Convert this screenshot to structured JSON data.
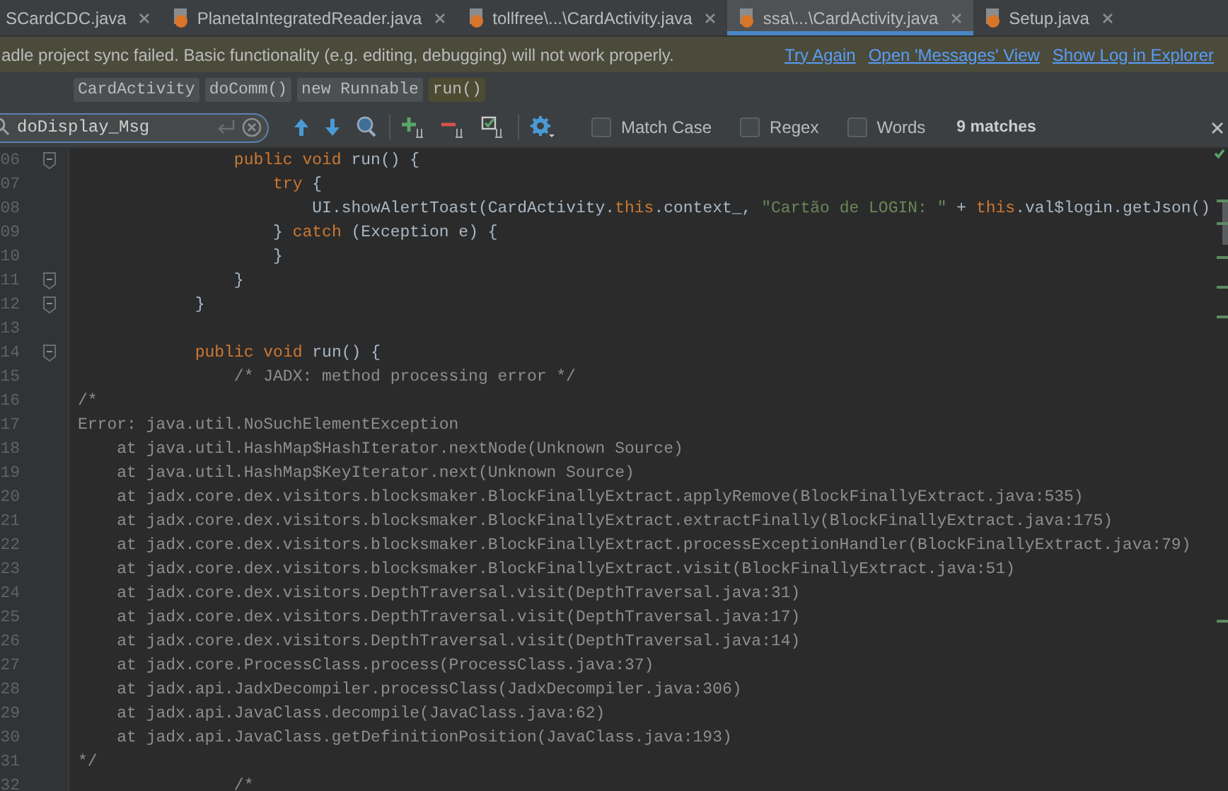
{
  "tabs": [
    {
      "label": "SCardCDC.java",
      "has_icon": false,
      "selected": false
    },
    {
      "label": "PlanetaIntegratedReader.java",
      "has_icon": true,
      "selected": false
    },
    {
      "label": "tollfree\\...\\CardActivity.java",
      "has_icon": true,
      "selected": false
    },
    {
      "label": "ssa\\...\\CardActivity.java",
      "has_icon": true,
      "selected": true
    },
    {
      "label": "Setup.java",
      "has_icon": true,
      "selected": false
    }
  ],
  "notification": {
    "message": "adle project sync failed. Basic functionality (e.g. editing, debugging) will not work properly.",
    "links": [
      "Try Again",
      "Open 'Messages' View",
      "Show Log in Explorer"
    ]
  },
  "breadcrumbs": [
    {
      "label": "CardActivity",
      "selected": false
    },
    {
      "label": "doComm()",
      "selected": false
    },
    {
      "label": "new Runnable",
      "selected": false
    },
    {
      "label": "run()",
      "selected": true
    }
  ],
  "search": {
    "value": "doDisplay_Msg",
    "options": [
      {
        "label": "Match Case",
        "checked": false
      },
      {
        "label": "Regex",
        "checked": false
      },
      {
        "label": "Words",
        "checked": false
      }
    ],
    "match_count": "9 matches"
  },
  "editor": {
    "lines": [
      {
        "number": "06",
        "fold": true,
        "tokens": [
          {
            "kind": "keyword",
            "text": "                public void"
          },
          {
            "kind": "plain",
            "text": " run() {"
          }
        ]
      },
      {
        "number": "07",
        "fold": false,
        "tokens": [
          {
            "kind": "keyword",
            "text": "                    try"
          },
          {
            "kind": "plain",
            "text": " {"
          }
        ]
      },
      {
        "number": "08",
        "fold": false,
        "tokens": [
          {
            "kind": "plain",
            "text": "                        UI.showAlertToast(CardActivity."
          },
          {
            "kind": "keyword",
            "text": "this"
          },
          {
            "kind": "plain",
            "text": ".context_, "
          },
          {
            "kind": "string",
            "text": "\"Cartão de LOGIN: \""
          },
          {
            "kind": "plain",
            "text": " + "
          },
          {
            "kind": "keyword",
            "text": "this"
          },
          {
            "kind": "plain",
            "text": ".val$login.getJson()"
          }
        ]
      },
      {
        "number": "09",
        "fold": false,
        "tokens": [
          {
            "kind": "plain",
            "text": "                    } "
          },
          {
            "kind": "keyword",
            "text": "catch"
          },
          {
            "kind": "plain",
            "text": " (Exception e) {"
          }
        ]
      },
      {
        "number": "10",
        "fold": false,
        "tokens": [
          {
            "kind": "plain",
            "text": "                    }"
          }
        ]
      },
      {
        "number": "11",
        "fold": true,
        "tokens": [
          {
            "kind": "plain",
            "text": "                }"
          }
        ]
      },
      {
        "number": "12",
        "fold": true,
        "tokens": [
          {
            "kind": "plain",
            "text": "            }"
          }
        ]
      },
      {
        "number": "13",
        "fold": false
      },
      {
        "number": "14",
        "fold": true,
        "tokens": [
          {
            "kind": "keyword",
            "text": "            public void"
          },
          {
            "kind": "plain",
            "text": " run() {"
          }
        ]
      },
      {
        "number": "15",
        "fold": false,
        "tokens": [
          {
            "kind": "comment",
            "text": "                /* JADX: method processing error */"
          }
        ]
      },
      {
        "number": "16",
        "fold": false,
        "tokens": [
          {
            "kind": "comment",
            "text": "/*"
          }
        ]
      },
      {
        "number": "17",
        "fold": false,
        "tokens": [
          {
            "kind": "comment",
            "text": "Error: java.util.NoSuchElementException"
          }
        ]
      },
      {
        "number": "18",
        "fold": false,
        "tokens": [
          {
            "kind": "comment",
            "text": "    at java.util.HashMap$HashIterator.nextNode(Unknown Source)"
          }
        ]
      },
      {
        "number": "19",
        "fold": false,
        "tokens": [
          {
            "kind": "comment",
            "text": "    at java.util.HashMap$KeyIterator.next(Unknown Source)"
          }
        ]
      },
      {
        "number": "20",
        "fold": false,
        "tokens": [
          {
            "kind": "comment",
            "text": "    at jadx.core.dex.visitors.blocksmaker.BlockFinallyExtract.applyRemove(BlockFinallyExtract.java:535)"
          }
        ]
      },
      {
        "number": "21",
        "fold": false,
        "tokens": [
          {
            "kind": "comment",
            "text": "    at jadx.core.dex.visitors.blocksmaker.BlockFinallyExtract.extractFinally(BlockFinallyExtract.java:175)"
          }
        ]
      },
      {
        "number": "22",
        "fold": false,
        "tokens": [
          {
            "kind": "comment",
            "text": "    at jadx.core.dex.visitors.blocksmaker.BlockFinallyExtract.processExceptionHandler(BlockFinallyExtract.java:79)"
          }
        ]
      },
      {
        "number": "23",
        "fold": false,
        "tokens": [
          {
            "kind": "comment",
            "text": "    at jadx.core.dex.visitors.blocksmaker.BlockFinallyExtract.visit(BlockFinallyExtract.java:51)"
          }
        ]
      },
      {
        "number": "24",
        "fold": false,
        "tokens": [
          {
            "kind": "comment",
            "text": "    at jadx.core.dex.visitors.DepthTraversal.visit(DepthTraversal.java:31)"
          }
        ]
      },
      {
        "number": "25",
        "fold": false,
        "tokens": [
          {
            "kind": "comment",
            "text": "    at jadx.core.dex.visitors.DepthTraversal.visit(DepthTraversal.java:17)"
          }
        ]
      },
      {
        "number": "26",
        "fold": false,
        "tokens": [
          {
            "kind": "comment",
            "text": "    at jadx.core.dex.visitors.DepthTraversal.visit(DepthTraversal.java:14)"
          }
        ]
      },
      {
        "number": "27",
        "fold": false,
        "tokens": [
          {
            "kind": "comment",
            "text": "    at jadx.core.ProcessClass.process(ProcessClass.java:37)"
          }
        ]
      },
      {
        "number": "28",
        "fold": false,
        "tokens": [
          {
            "kind": "comment",
            "text": "    at jadx.api.JadxDecompiler.processClass(JadxDecompiler.java:306)"
          }
        ]
      },
      {
        "number": "29",
        "fold": false,
        "tokens": [
          {
            "kind": "comment",
            "text": "    at jadx.api.JavaClass.decompile(JavaClass.java:62)"
          }
        ]
      },
      {
        "number": "30",
        "fold": false,
        "tokens": [
          {
            "kind": "comment",
            "text": "    at jadx.api.JavaClass.getDefinitionPosition(JavaClass.java:193)"
          }
        ]
      },
      {
        "number": "31",
        "fold": false,
        "tokens": [
          {
            "kind": "comment",
            "text": "*/"
          }
        ]
      },
      {
        "number": "32",
        "fold": false,
        "tokens": [
          {
            "kind": "comment",
            "text": "                /*"
          }
        ]
      }
    ]
  }
}
